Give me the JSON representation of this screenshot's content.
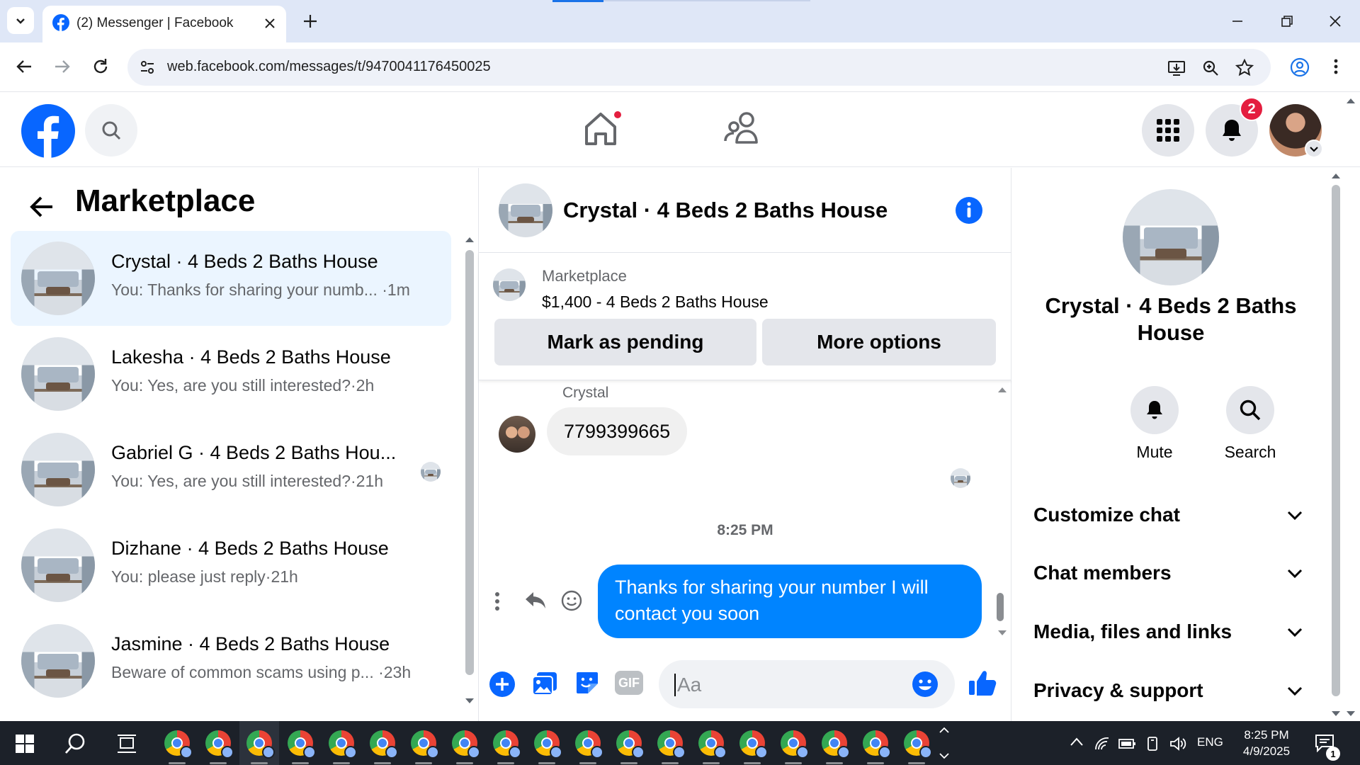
{
  "browser": {
    "tab_title": "(2) Messenger | Facebook",
    "url": "web.facebook.com/messages/t/9470041176450025"
  },
  "header": {
    "notifications_count": "2"
  },
  "left_panel": {
    "title": "Marketplace",
    "conversations": [
      {
        "name": "Crystal · 4 Beds 2 Baths House",
        "snippet": "You: Thanks for sharing your numb... ·1m",
        "active": true
      },
      {
        "name": "Lakesha · 4 Beds 2 Baths House",
        "snippet": "You: Yes, are you still interested?·2h",
        "active": false
      },
      {
        "name": "Gabriel G · 4 Beds 2 Baths Hou...",
        "snippet": "You: Yes, are you still interested?·21h",
        "active": false
      },
      {
        "name": "Dizhane · 4 Beds 2 Baths House",
        "snippet": "You: please just reply·21h",
        "active": false
      },
      {
        "name": "Jasmine · 4 Beds 2 Baths House",
        "snippet": "Beware of common scams using p... ·23h",
        "active": false
      }
    ]
  },
  "chat": {
    "title": "Crystal · 4 Beds 2 Baths House",
    "listing": {
      "source": "Marketplace",
      "title": "$1,400 - 4 Beds 2 Baths House",
      "mark_pending_label": "Mark as pending",
      "more_options_label": "More options"
    },
    "messages": {
      "incoming_sender": "Crystal",
      "incoming_text": "7799399665",
      "time_divider": "8:25 PM",
      "outgoing_text": "Thanks for sharing your number I will contact you soon"
    },
    "composer": {
      "placeholder": "Aa",
      "gif_label": "GIF"
    }
  },
  "info_panel": {
    "title": "Crystal · 4 Beds 2 Baths House",
    "mute_label": "Mute",
    "search_label": "Search",
    "sections": [
      "Customize chat",
      "Chat members",
      "Media, files and links",
      "Privacy & support"
    ]
  },
  "taskbar": {
    "language": "ENG",
    "time": "8:25 PM",
    "date": "4/9/2025",
    "notifications": "1"
  },
  "colors": {
    "facebook_blue": "#0866ff",
    "message_blue": "#0084ff",
    "active_conversation": "#ebf5ff",
    "badge_red": "#e41e3f"
  }
}
